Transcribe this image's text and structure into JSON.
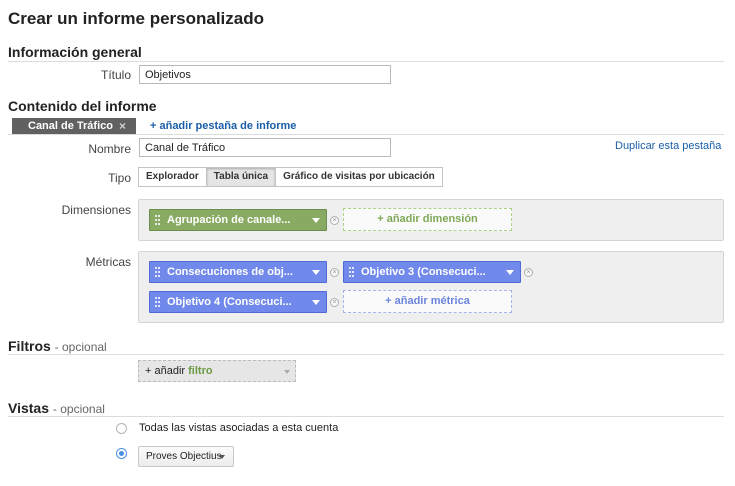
{
  "page": {
    "title": "Crear un informe personalizado"
  },
  "general": {
    "heading": "Información general",
    "title_label": "Título",
    "title_value": "Objetivos"
  },
  "content": {
    "heading": "Contenido del informe",
    "tab_name": "Canal de Tráfico",
    "tab_close": "×",
    "add_tab": "+ añadir pestaña de informe",
    "name_label": "Nombre",
    "name_value": "Canal de Tráfico",
    "duplicate_tab": "Duplicar esta pestaña",
    "type_label": "Tipo",
    "types": [
      "Explorador",
      "Tabla única",
      "Gráfico de visitas por ubicación"
    ],
    "selected_type": "Tabla única",
    "dimensions_label": "Dimensiones",
    "dimensions": [
      "Agrupación de canale..."
    ],
    "add_dimension": "+ añadir dimensión",
    "metrics_label": "Métricas",
    "metrics": [
      "Consecuciones de obj...",
      "Objetivo 3 (Consecuci...",
      "Objetivo 4 (Consecuci..."
    ],
    "add_metric": "+ añadir métrica"
  },
  "filters": {
    "heading": "Filtros",
    "optional": "- opcional",
    "add_prefix": "+ añadir",
    "add_word": "filtro"
  },
  "views": {
    "heading": "Vistas",
    "optional": "- opcional",
    "option_all": "Todas las vistas asociadas a esta cuenta",
    "selected_view": "Proves Objectius"
  },
  "colors": {
    "dimension_pill": "#88aa62",
    "metric_pill": "#7289ec",
    "link": "#1a5ea8",
    "radio_selected": "#4a90e2"
  }
}
